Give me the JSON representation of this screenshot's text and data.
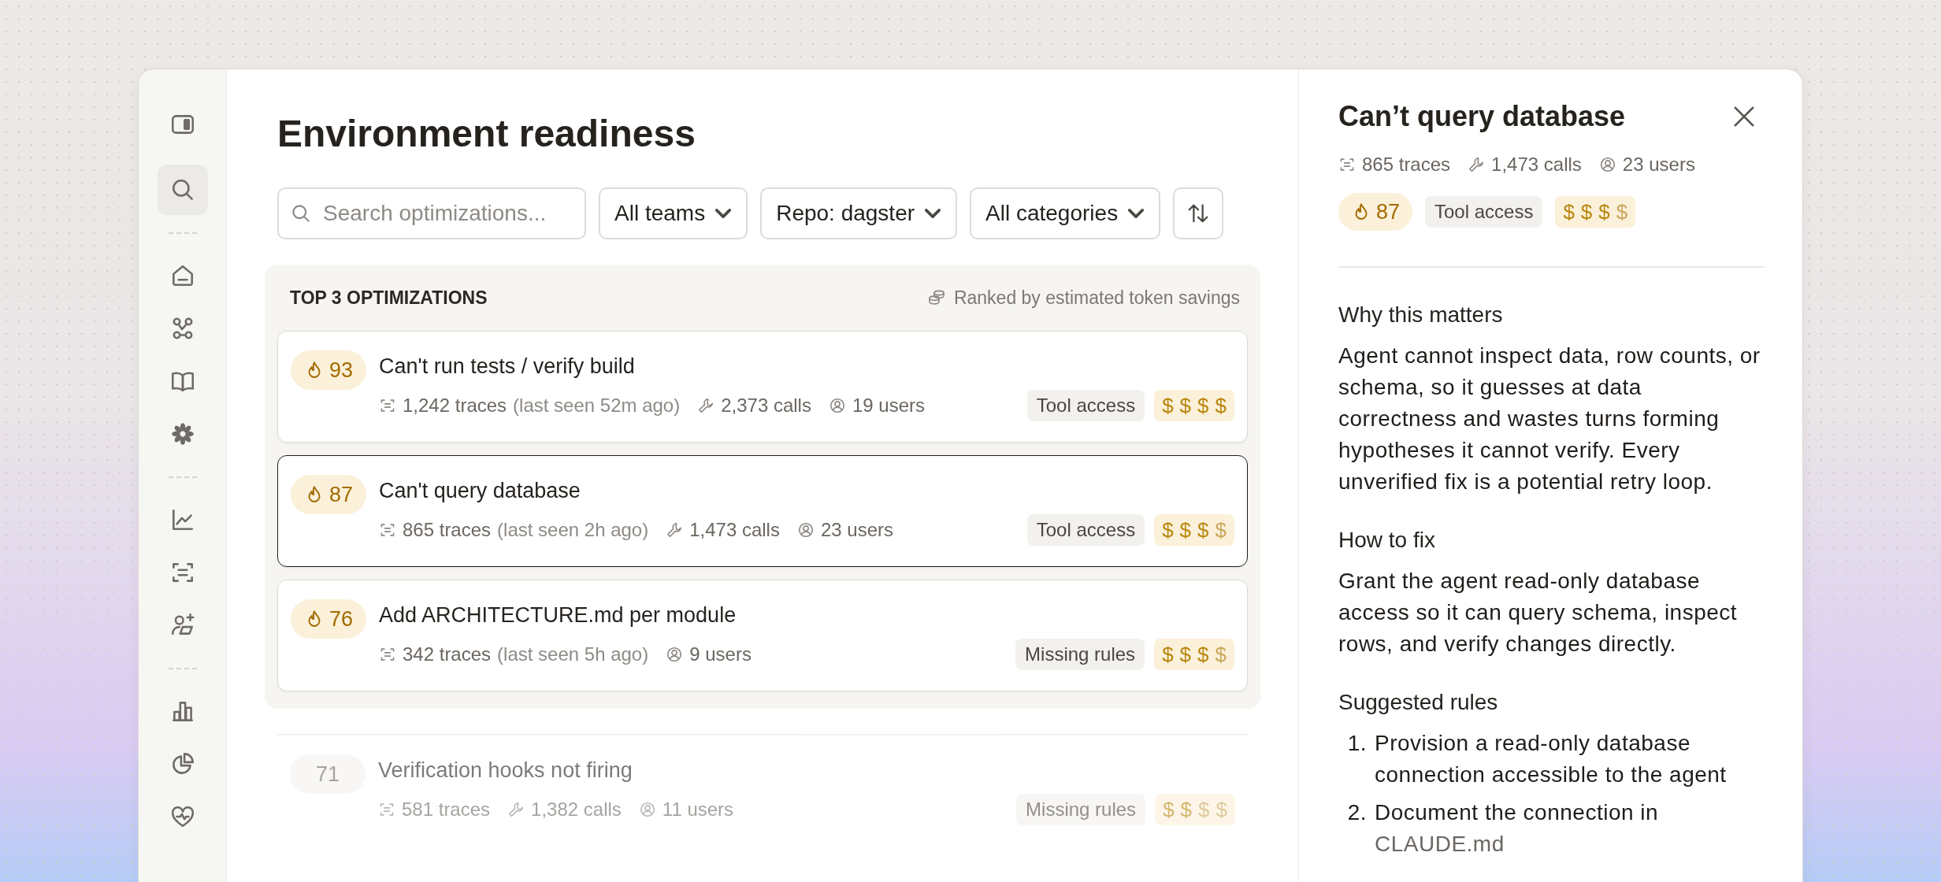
{
  "sidebar": {
    "toggle": {
      "kind": "panel"
    },
    "groups": [
      [
        {
          "kind": "search",
          "selected": true
        }
      ],
      [
        {
          "kind": "home",
          "selected": false
        },
        {
          "kind": "graph",
          "selected": false
        },
        {
          "kind": "book",
          "selected": false
        },
        {
          "kind": "flower",
          "selected": false
        }
      ],
      [
        {
          "kind": "linechart",
          "selected": false
        },
        {
          "kind": "scan",
          "selected": false
        },
        {
          "kind": "usersparkle",
          "selected": false
        }
      ],
      [
        {
          "kind": "barchart",
          "selected": false
        },
        {
          "kind": "pie",
          "selected": false
        },
        {
          "kind": "heart",
          "selected": false
        }
      ]
    ]
  },
  "page": {
    "title": "Environment readiness"
  },
  "filters": {
    "search": {
      "placeholder": "Search optimizations..."
    },
    "dropdowns": [
      {
        "label": "All teams"
      },
      {
        "label": "Repo: dagster"
      },
      {
        "label": "All categories"
      }
    ]
  },
  "top_section": {
    "heading": "TOP 3 OPTIMIZATIONS",
    "note": "Ranked by estimated token savings",
    "items": [
      {
        "score": "93",
        "hot": true,
        "selected": false,
        "title": "Can't run tests / verify build",
        "meta": [
          {
            "kind": "traces",
            "text": "1,242 traces",
            "note": "(last seen 52m ago)"
          },
          {
            "kind": "calls",
            "text": "2,373 calls"
          },
          {
            "kind": "users",
            "text": "19 users"
          }
        ],
        "tag": "Tool access",
        "cost": [
          {
            "symbol": "$",
            "filled": true
          },
          {
            "symbol": "$",
            "filled": true
          },
          {
            "symbol": "$",
            "filled": true
          },
          {
            "symbol": "$",
            "filled": true
          }
        ]
      },
      {
        "score": "87",
        "hot": true,
        "selected": true,
        "title": "Can't query database",
        "meta": [
          {
            "kind": "traces",
            "text": "865 traces",
            "note": "(last seen 2h ago)"
          },
          {
            "kind": "calls",
            "text": "1,473 calls"
          },
          {
            "kind": "users",
            "text": "23 users"
          }
        ],
        "tag": "Tool access",
        "cost": [
          {
            "symbol": "$",
            "filled": true
          },
          {
            "symbol": "$",
            "filled": true
          },
          {
            "symbol": "$",
            "filled": true
          },
          {
            "symbol": "$",
            "filled": false
          }
        ]
      },
      {
        "score": "76",
        "hot": true,
        "selected": false,
        "title": "Add ARCHITECTURE.md per module",
        "meta": [
          {
            "kind": "traces",
            "text": "342 traces",
            "note": "(last seen 5h ago)"
          },
          {
            "kind": "users",
            "text": "9 users"
          }
        ],
        "tag": "Missing rules",
        "cost": [
          {
            "symbol": "$",
            "filled": true
          },
          {
            "symbol": "$",
            "filled": true
          },
          {
            "symbol": "$",
            "filled": true
          },
          {
            "symbol": "$",
            "filled": false
          }
        ]
      }
    ]
  },
  "more_items": [
    {
      "score": "71",
      "hot": false,
      "selected": false,
      "title": "Verification hooks not firing",
      "meta": [
        {
          "kind": "traces",
          "text": "581 traces"
        },
        {
          "kind": "calls",
          "text": "1,382 calls"
        },
        {
          "kind": "users",
          "text": "11 users"
        }
      ],
      "tag": "Missing rules",
      "cost": [
        {
          "symbol": "$",
          "filled": true
        },
        {
          "symbol": "$",
          "filled": true
        },
        {
          "symbol": "$",
          "filled": false
        },
        {
          "symbol": "$",
          "filled": false
        }
      ]
    }
  ],
  "detail": {
    "title": "Can’t query database",
    "meta": [
      {
        "kind": "traces",
        "text": "865 traces"
      },
      {
        "kind": "calls",
        "text": "1,473 calls"
      },
      {
        "kind": "users",
        "text": "23 users"
      }
    ],
    "score": "87",
    "hot": true,
    "tag": "Tool access",
    "cost": [
      {
        "symbol": "$",
        "filled": true
      },
      {
        "symbol": "$",
        "filled": true
      },
      {
        "symbol": "$",
        "filled": true
      },
      {
        "symbol": "$",
        "filled": false
      }
    ],
    "sections": [
      {
        "kind": "paragraph",
        "heading": "Why this matters",
        "text": "Agent cannot inspect data, row counts, or schema, so it guesses at data correctness and wastes turns forming hypotheses it cannot verify. Every unverified fix is a potential retry loop."
      },
      {
        "kind": "paragraph",
        "heading": "How to fix",
        "text": "Grant the agent read-only database access so it can query schema, inspect rows, and verify changes directly."
      },
      {
        "kind": "list",
        "heading": "Suggested rules",
        "items": [
          {
            "number": "1.",
            "text": "Provision a read-only database connection accessible to the agent"
          },
          {
            "number": "2.",
            "text": "Document the connection in",
            "code": "CLAUDE.md"
          }
        ]
      }
    ]
  }
}
